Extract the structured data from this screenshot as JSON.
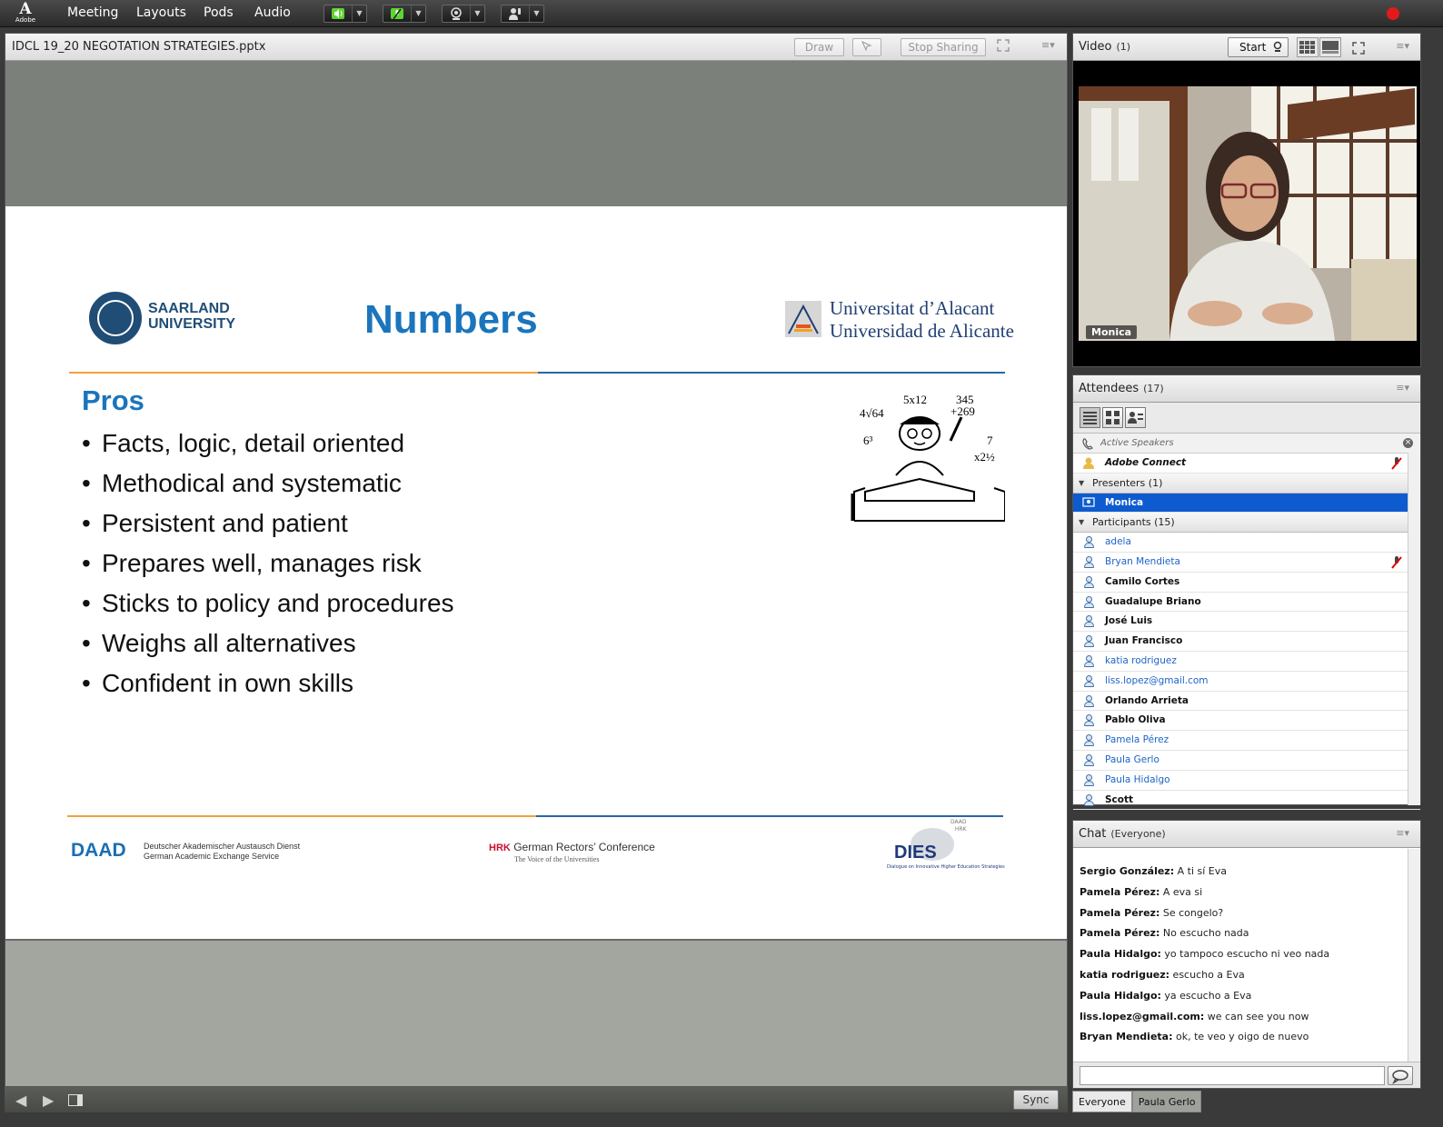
{
  "topbar": {
    "brand": "Adobe",
    "menus": [
      "Meeting",
      "Layouts",
      "Pods",
      "Audio"
    ]
  },
  "share": {
    "title": "IDCL 19_20 NEGOTATION STRATEGIES.pptx",
    "draw_label": "Draw",
    "stop_sharing_label": "Stop Sharing",
    "sync_label": "Sync"
  },
  "slide": {
    "left_logo_text": [
      "SAARLAND",
      "UNIVERSITY"
    ],
    "title": "Numbers",
    "right_logo_text": [
      "Universitat d’Alacant",
      "Universidad de Alicante"
    ],
    "section_heading": "Pros",
    "bullets": [
      "Facts, logic, detail oriented",
      "Methodical and systematic",
      "Persistent and patient",
      "Prepares well, manages risk",
      "Sticks to policy and procedures",
      "Weighs all alternatives",
      "Confident in own skills"
    ],
    "footer": {
      "daad": "DAAD",
      "daad_sub": [
        "Deutscher Akademischer Austausch Dienst",
        "German Academic Exchange Service"
      ],
      "hrk_mark": "HRK",
      "hrk_name": "German Rectors’ Conference",
      "hrk_sub": "The Voice of the Universities",
      "dies": "DIES",
      "dies_top": [
        "DAAD",
        "HRK"
      ],
      "dies_sub": "Dialogue on Innovative Higher Education Strategies"
    },
    "cartoon_numbers": [
      "5x12",
      "345",
      "+269",
      "4√64",
      "6³",
      "7",
      "x2½"
    ]
  },
  "video": {
    "title": "Video",
    "count": "(1)",
    "start_label": "Start",
    "speaker_name": "Monica"
  },
  "attendees": {
    "title": "Attendees",
    "count": "(17)",
    "active_speakers_label": "Active Speakers",
    "host": "Adobe Connect",
    "presenters_label": "Presenters (1)",
    "presenters": [
      "Monica"
    ],
    "participants_label": "Participants (15)",
    "participants": [
      {
        "name": "adela",
        "style": "blue",
        "mic": false
      },
      {
        "name": "Bryan Mendieta",
        "style": "blue",
        "mic": true
      },
      {
        "name": "Camilo Cortes",
        "style": "black",
        "mic": false
      },
      {
        "name": "Guadalupe Briano",
        "style": "black",
        "mic": false
      },
      {
        "name": "José Luis",
        "style": "black",
        "mic": false
      },
      {
        "name": "Juan Francisco",
        "style": "black",
        "mic": false
      },
      {
        "name": "katia rodriguez",
        "style": "blue",
        "mic": false
      },
      {
        "name": "liss.lopez@gmail.com",
        "style": "blue",
        "mic": false
      },
      {
        "name": "Orlando Arrieta",
        "style": "black",
        "mic": false
      },
      {
        "name": "Pablo Oliva",
        "style": "black",
        "mic": false
      },
      {
        "name": "Pamela Pérez",
        "style": "blue",
        "mic": false
      },
      {
        "name": "Paula Gerlo",
        "style": "blue",
        "mic": false
      },
      {
        "name": "Paula Hidalgo",
        "style": "blue",
        "mic": false
      },
      {
        "name": "Scott",
        "style": "black",
        "mic": false
      }
    ]
  },
  "chat": {
    "title": "Chat",
    "scope": "(Everyone)",
    "messages": [
      {
        "from": "Sergio González:",
        "text": "A ti sí Eva"
      },
      {
        "from": "Pamela Pérez:",
        "text": "A eva si"
      },
      {
        "from": "Pamela Pérez:",
        "text": "Se congelo?"
      },
      {
        "from": "Pamela Pérez:",
        "text": "No escucho nada"
      },
      {
        "from": "Paula Hidalgo:",
        "text": "yo tampoco escucho ni veo nada"
      },
      {
        "from": "katia rodriguez:",
        "text": "escucho a Eva"
      },
      {
        "from": "Paula Hidalgo:",
        "text": "ya escucho a Eva"
      },
      {
        "from": "liss.lopez@gmail.com:",
        "text": "we can see you now"
      },
      {
        "from": "Bryan Mendieta:",
        "text": "ok, te veo y oigo de nuevo"
      }
    ],
    "input_value": "",
    "tabs": [
      "Everyone",
      "Paula Gerlo"
    ]
  },
  "colors": {
    "accent_blue": "#1b75bc",
    "selected_row": "#0e5bd0",
    "record_red": "#e21a1a",
    "speaker_green": "#5cd62e"
  }
}
